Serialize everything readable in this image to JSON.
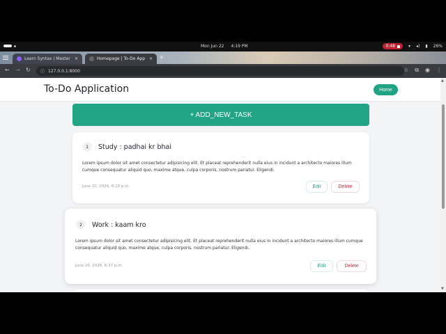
{
  "os": {
    "date": "Mon Jun 22",
    "time": "4:19 PM",
    "recording": "0:48",
    "battery": "26%"
  },
  "browser": {
    "tabs": [
      {
        "title": "Learn Syntax | Master W"
      },
      {
        "title": "Homepage | To-Do App"
      }
    ],
    "new_tab": "+",
    "url": "127.0.0.1:8000"
  },
  "app": {
    "brand": "To-Do Application",
    "home_label": "Home",
    "add_task_label": "+ ADD_NEW_TASK",
    "tasks": [
      {
        "num": "1",
        "title": "Study : padhai kr bhai",
        "desc": "Lorem ipsum dolor sit amet consectetur adipisicing elit. Et placeat reprehenderit nulla eius in incidunt a architecto maiores illum cumque consequatur aliquid quo, maxime atque, culpa corporis, nostrum pariatur. Eligendi.",
        "date": "June 20, 2026, 6:15 p.m.",
        "edit_label": "Edit",
        "delete_label": "Delete"
      },
      {
        "num": "2",
        "title": "Work : kaam kro",
        "desc": "Lorem ipsum dolor sit amet consectetur adipisicing elit. Et placeat reprehenderit nulla eius in incidunt a architecto maiores illum cumque consequatur aliquid quo, maxime atque, culpa corporis, nostrum pariatur. Eligendi.",
        "date": "June 20, 2026, 6:37 p.m.",
        "edit_label": "Edit",
        "delete_label": "Delete"
      }
    ]
  },
  "colors": {
    "accent": "#21a585",
    "danger": "#c8323f"
  }
}
